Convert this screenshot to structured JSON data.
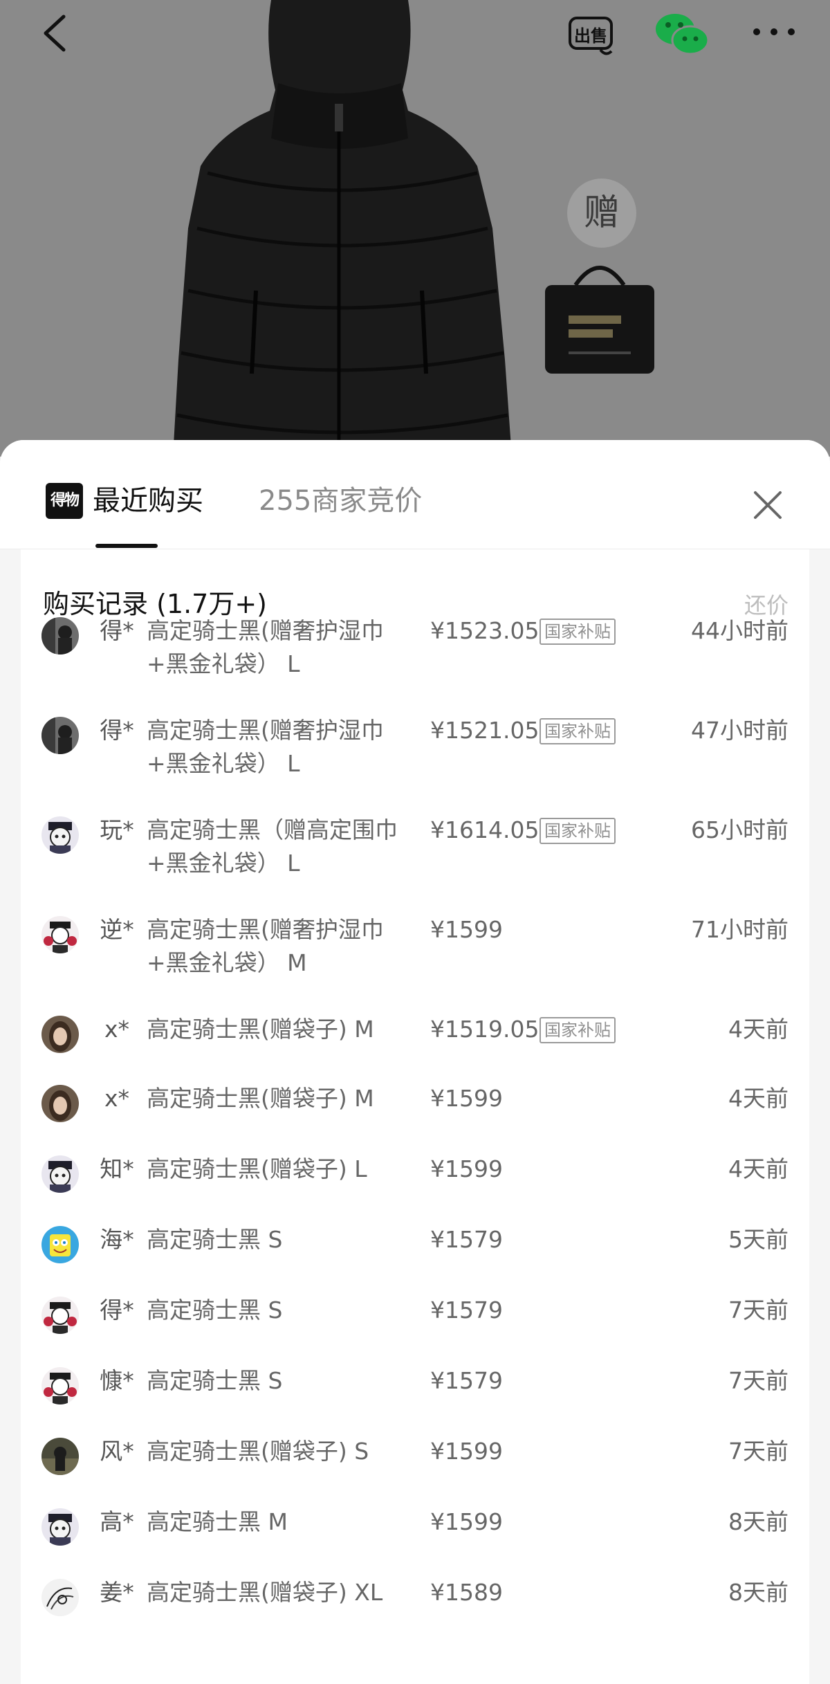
{
  "header": {
    "gift_char": "赠",
    "icons": [
      "back-icon",
      "sell-icon",
      "wechat-icon",
      "more-icon"
    ],
    "sell_label": "出售"
  },
  "sheet": {
    "logo_text": "得物",
    "tab_recent": "最近购买",
    "tab_bids": "255商家竞价",
    "card_title": "购买记录 (1.7万+)",
    "counter_offer": "还价"
  },
  "records": [
    {
      "user": "得*",
      "product": "高定骑士黑(赠奢护湿巾+黑金礼袋） L",
      "price": "¥1523.05",
      "badge": "国家补贴",
      "time": "44小时前",
      "avatar": "photo-street"
    },
    {
      "user": "得*",
      "product": "高定骑士黑(赠奢护湿巾+黑金礼袋） L",
      "price": "¥1521.05",
      "badge": "国家补贴",
      "time": "47小时前",
      "avatar": "photo-street"
    },
    {
      "user": "玩*",
      "product": "高定骑士黑（赠高定围巾+黑金礼袋） L",
      "price": "¥1614.05",
      "badge": "国家补贴",
      "time": "65小时前",
      "avatar": "cartoon-cap"
    },
    {
      "user": "逆*",
      "product": "高定骑士黑(赠奢护湿巾+黑金礼袋） M",
      "price": "¥1599",
      "badge": "",
      "time": "71小时前",
      "avatar": "cartoon-red"
    },
    {
      "user": "x*",
      "product": "高定骑士黑(赠袋子) M",
      "price": "¥1519.05",
      "badge": "国家补贴",
      "time": "4天前",
      "avatar": "photo-girl"
    },
    {
      "user": "x*",
      "product": "高定骑士黑(赠袋子) M",
      "price": "¥1599",
      "badge": "",
      "time": "4天前",
      "avatar": "photo-girl"
    },
    {
      "user": "知*",
      "product": "高定骑士黑(赠袋子) L",
      "price": "¥1599",
      "badge": "",
      "time": "4天前",
      "avatar": "cartoon-cap"
    },
    {
      "user": "海*",
      "product": "高定骑士黑 S",
      "price": "¥1579",
      "badge": "",
      "time": "5天前",
      "avatar": "sponge"
    },
    {
      "user": "得*",
      "product": "高定骑士黑 S",
      "price": "¥1579",
      "badge": "",
      "time": "7天前",
      "avatar": "cartoon-red"
    },
    {
      "user": "慷*",
      "product": "高定骑士黑 S",
      "price": "¥1579",
      "badge": "",
      "time": "7天前",
      "avatar": "cartoon-red"
    },
    {
      "user": "风*",
      "product": "高定骑士黑(赠袋子) S",
      "price": "¥1599",
      "badge": "",
      "time": "7天前",
      "avatar": "photo-dark"
    },
    {
      "user": "高*",
      "product": "高定骑士黑 M",
      "price": "¥1599",
      "badge": "",
      "time": "8天前",
      "avatar": "cartoon-cap"
    },
    {
      "user": "姜*",
      "product": "高定骑士黑(赠袋子) XL",
      "price": "¥1589",
      "badge": "",
      "time": "8天前",
      "avatar": "sketch"
    }
  ]
}
